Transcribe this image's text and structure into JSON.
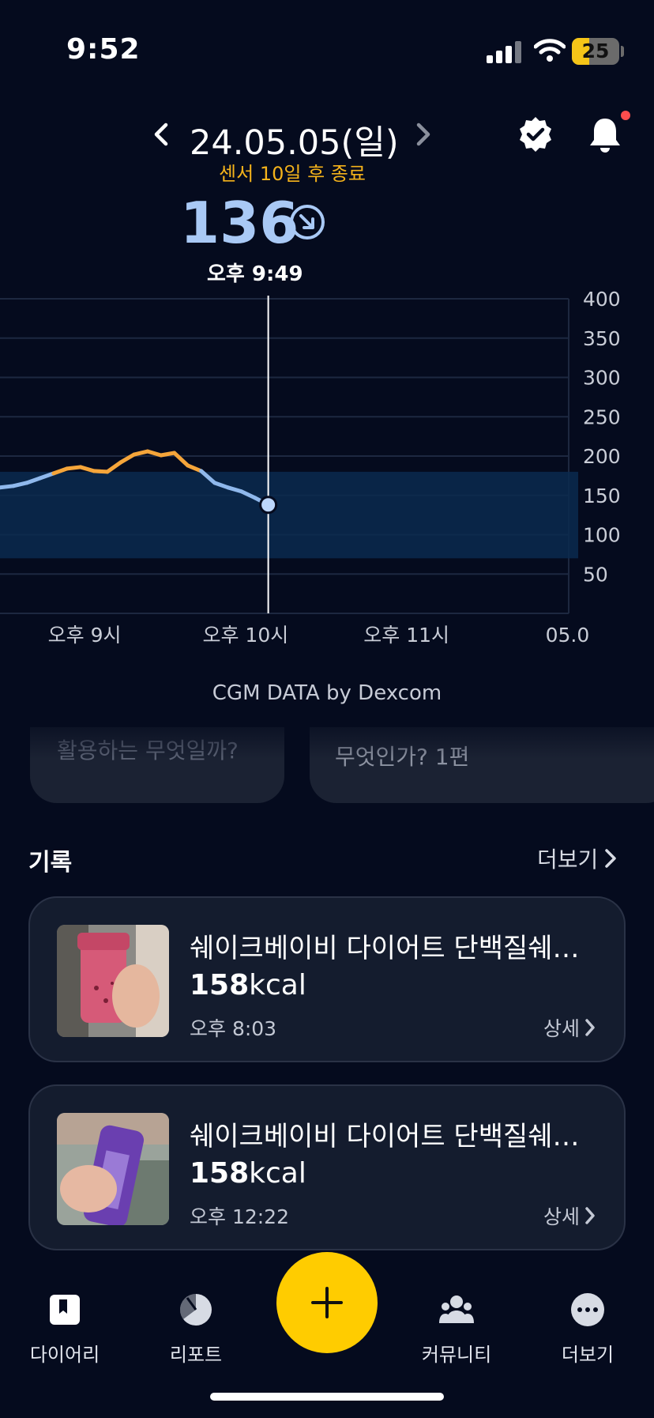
{
  "status_bar": {
    "time": "9:52",
    "battery": "25"
  },
  "header": {
    "date": "24.05.05(일)",
    "sensor_message": "센서 10일 후 종료"
  },
  "current_reading": {
    "value": "136",
    "time": "오후 9:49"
  },
  "chart_data": {
    "type": "line",
    "y_ticks": [
      "400",
      "350",
      "300",
      "250",
      "200",
      "150",
      "100",
      "50"
    ],
    "ylim": [
      0,
      400
    ],
    "x_ticks": [
      "오후 9시",
      "오후 10시",
      "오후 11시",
      "05.0"
    ],
    "target_range": [
      70,
      180
    ],
    "series": [
      {
        "values": [
          {
            "x": "20:32",
            "y": 160
          },
          {
            "x": "20:37",
            "y": 162
          },
          {
            "x": "20:42",
            "y": 166
          },
          {
            "x": "20:47",
            "y": 172
          },
          {
            "x": "20:52",
            "y": 178
          },
          {
            "x": "20:57",
            "y": 184
          },
          {
            "x": "21:02",
            "y": 186
          },
          {
            "x": "21:07",
            "y": 181
          },
          {
            "x": "21:12",
            "y": 180
          },
          {
            "x": "21:17",
            "y": 192
          },
          {
            "x": "21:22",
            "y": 202
          },
          {
            "x": "21:27",
            "y": 206
          },
          {
            "x": "21:32",
            "y": 201
          },
          {
            "x": "21:37",
            "y": 204
          },
          {
            "x": "21:42",
            "y": 188
          },
          {
            "x": "21:47",
            "y": 181
          },
          {
            "x": "21:52",
            "y": 166
          },
          {
            "x": "21:57",
            "y": 160
          },
          {
            "x": "22:02",
            "y": 155
          },
          {
            "x": "22:07",
            "y": 147
          },
          {
            "x": "22:12",
            "y": 138
          }
        ]
      }
    ],
    "colors": {
      "in_range": "#8fb8ec",
      "high": "#f5a53a",
      "target_band": "#0b2a4f"
    },
    "grid": true
  },
  "credit": "CGM DATA by Dexcom",
  "faded_cards": [
    "활용하는 무엇일까?",
    "무엇인가? 1편"
  ],
  "records": {
    "title": "기록",
    "more": "더보기",
    "items": [
      {
        "name": "쉐이크베이비 다이어트 단백질쉐…",
        "kcal_value": "158",
        "kcal_unit": "kcal",
        "time": "오후 8:03",
        "detail": "상세"
      },
      {
        "name": "쉐이크베이비 다이어트 단백질쉐…",
        "kcal_value": "158",
        "kcal_unit": "kcal",
        "time": "오후 12:22",
        "detail": "상세"
      }
    ]
  },
  "nav": {
    "diary": "다이어리",
    "report": "리포트",
    "community": "커뮤니티",
    "more": "더보기"
  }
}
